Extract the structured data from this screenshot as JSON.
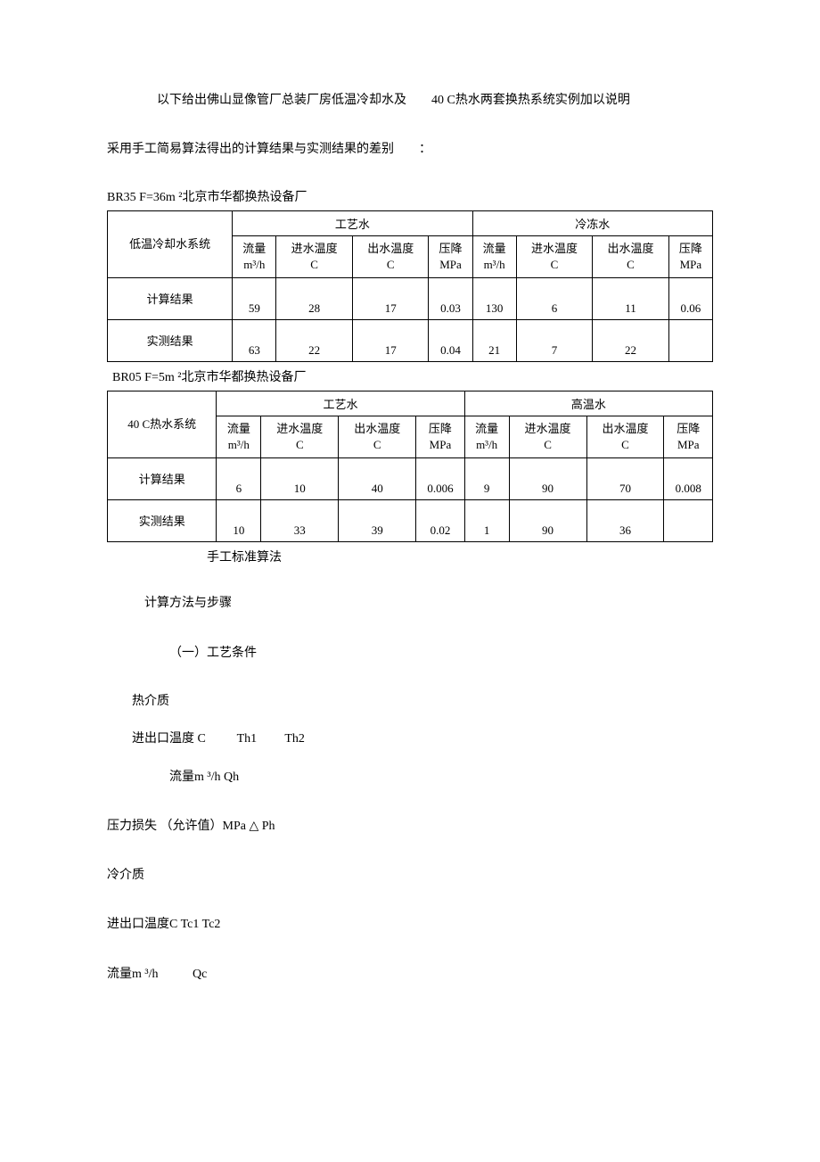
{
  "intro": {
    "line1_a": "以下给出佛山显像管厂总装厂房低温冷却水及",
    "line1_b": "40 C热水两套换热系统实例加以说明",
    "line2": "采用手工简易算法得出的计算结果与实测结果的差别",
    "line2_punct": "："
  },
  "table1": {
    "caption": "BR35 F=36m ²北京市华都换热设备厂",
    "row_header": "低温冷却水系统",
    "group1": "工艺水",
    "group2": "冷冻水",
    "cols": {
      "flow": "流量",
      "flow_unit": "m³/h",
      "tin": "进水温度",
      "tout": "出水温度",
      "temp_unit": "C",
      "dp": "压降",
      "dp_unit": "MPa"
    },
    "rows": [
      {
        "label": "计算结果",
        "v": [
          "59",
          "28",
          "17",
          "0.03",
          "130",
          "6",
          "11",
          "0.06"
        ]
      },
      {
        "label": "实测结果",
        "v": [
          "63",
          "22",
          "17",
          "0.04",
          "21",
          "7",
          "22",
          ""
        ]
      }
    ]
  },
  "table2": {
    "caption": "BR05 F=5m ²北京市华都换热设备厂",
    "row_header": "40 C热水系统",
    "group1": "工艺水",
    "group2": "高温水",
    "cols": {
      "flow": "流量",
      "flow_unit": "m³/h",
      "tin": "进水温度",
      "tout": "出水温度",
      "temp_unit": "C",
      "dp": "压降",
      "dp_unit": "MPa"
    },
    "rows": [
      {
        "label": "计算结果",
        "v": [
          "6",
          "10",
          "40",
          "0.006",
          "9",
          "90",
          "70",
          "0.008"
        ]
      },
      {
        "label": "实测结果",
        "v": [
          "10",
          "33",
          "39",
          "0.02",
          "1",
          "90",
          "36",
          ""
        ]
      }
    ]
  },
  "body": {
    "method_title": "手工标准算法",
    "steps_title": "计算方法与步骤",
    "subsection1": "（一）工艺条件",
    "hot_medium": "热介质",
    "hot_temp": "进出口温度 C          Th1         Th2",
    "hot_flow": "流量m ³/h Qh",
    "hot_dp": "压力损失 （允许值）MPa △ Ph",
    "cold_medium": "冷介质",
    "cold_temp": "进出口温度C Tc1 Tc2",
    "cold_flow": "流量m ³/h           Qc"
  }
}
